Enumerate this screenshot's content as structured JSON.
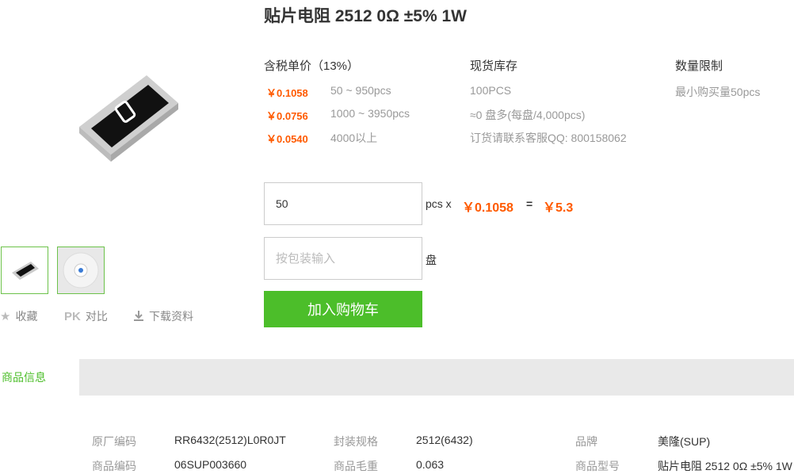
{
  "product": {
    "title": "贴片电阻 2512 0Ω ±5% 1W"
  },
  "actions": {
    "favorite": "收藏",
    "pk_badge": "PK",
    "compare": "对比",
    "download": "下载资料"
  },
  "pricing": {
    "header": "含税单价（13%）",
    "tiers": [
      {
        "price": "￥0.1058",
        "range": "50 ~ 950pcs"
      },
      {
        "price": "￥0.0756",
        "range": "1000 ~ 3950pcs"
      },
      {
        "price": "￥0.0540",
        "range": "4000以上"
      }
    ]
  },
  "stock": {
    "header": "现货库存",
    "lines": [
      "100PCS",
      "≈0 盘多(每盘/4,000pcs)",
      "订货请联系客服QQ: 800158062"
    ]
  },
  "limit": {
    "header": "数量限制",
    "min": "最小购买量50pcs"
  },
  "order": {
    "quantity_value": "50",
    "unit_x": "pcs x",
    "unit_price": "￥0.1058",
    "equals": "=",
    "total": "￥5.3",
    "package_placeholder": "按包装输入",
    "package_unit": "盘",
    "add_to_cart": "加入购物车"
  },
  "tabs": {
    "info": "商品信息"
  },
  "specs": [
    {
      "label": "原厂编码",
      "value": "RR6432(2512)L0R0JT"
    },
    {
      "label": "封装规格",
      "value": "2512(6432)"
    },
    {
      "label": "品牌",
      "value": "美隆(SUP)"
    },
    {
      "label": "商品编码",
      "value": "06SUP003660"
    },
    {
      "label": "商品毛重",
      "value": "0.063"
    },
    {
      "label": "商品型号",
      "value": "贴片电阻 2512 0Ω ±5% 1W"
    }
  ],
  "colors": {
    "accent_green": "#4cbe2a",
    "price_orange": "#ff5a00"
  }
}
